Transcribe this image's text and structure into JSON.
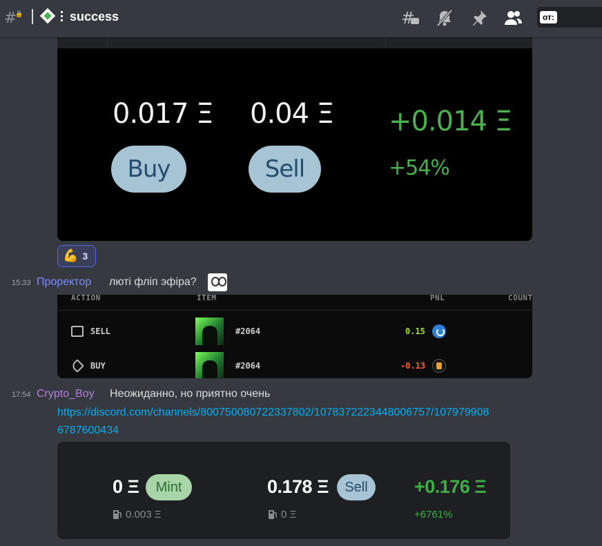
{
  "header": {
    "channel_name": "success",
    "search_filter_chip": "от:"
  },
  "embed_card_1": {
    "buy_price": "0.017 Ξ",
    "sell_price": "0.04 Ξ",
    "profit": "+0.014 Ξ",
    "buy_label": "Buy",
    "sell_label": "Sell",
    "percent": "+54%"
  },
  "reaction": {
    "emoji": "💪",
    "count": "3"
  },
  "messages": [
    {
      "time": "15:33",
      "author": "Проректор",
      "author_color": "#7b8cff",
      "text": "люті фліп эфіра?"
    },
    {
      "time": "17:54",
      "author": "Crypto_Boy",
      "author_color": "#b57edc",
      "text": "Неожиданно, но приятно очень",
      "link_line1": "https://discord.com/channels/800750080722337802/1078372223448006757/107979908",
      "link_line2": "6787600434"
    }
  ],
  "embed_table": {
    "columns": [
      "ACTION",
      "ITEM",
      "PNL",
      "COUNT"
    ],
    "rows": [
      {
        "action": "SELL",
        "item": "#2064",
        "pnl": "0.15",
        "pnl_color": "#a6e22e"
      },
      {
        "action": "BUY",
        "item": "#2064",
        "pnl": "-0.13",
        "pnl_color": "#ff5f3a"
      }
    ]
  },
  "embed_card_3": {
    "mint_price": "0 Ξ",
    "mint_label": "Mint",
    "mint_gas": "0.003 Ξ",
    "sell_price": "0.178 Ξ",
    "sell_label": "Sell",
    "sell_gas": "0 Ξ",
    "profit": "+0.176 Ξ",
    "percent": "+6761%"
  }
}
